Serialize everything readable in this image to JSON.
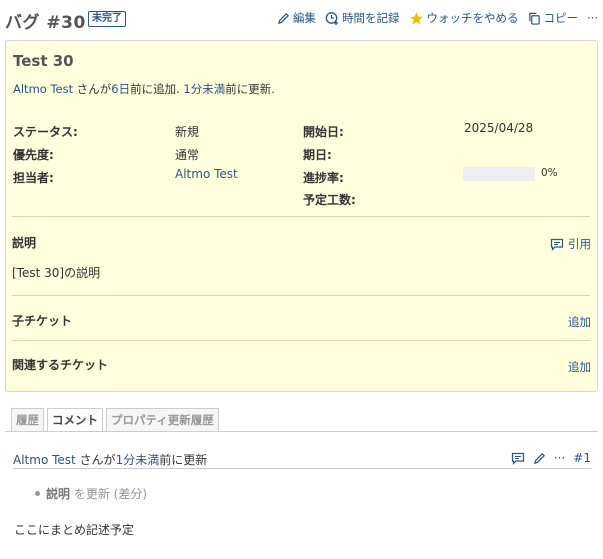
{
  "header": {
    "title": "バグ #30",
    "status_badge": "未完了",
    "actions": {
      "edit": "編集",
      "log_time": "時間を記録",
      "unwatch": "ウォッチをやめる",
      "copy": "コピー",
      "more": "···"
    }
  },
  "issue": {
    "subject": "Test 30",
    "author_line": {
      "author": "Altmo Test",
      "text1": " さんが",
      "added": "6日",
      "text2": "前に追加. ",
      "updated": "1分未満",
      "text3": "前に更新."
    },
    "attributes": {
      "status_label": "ステータス:",
      "status_value": "新規",
      "priority_label": "優先度:",
      "priority_value": "通常",
      "assignee_label": "担当者:",
      "assignee_value": "Altmo Test",
      "start_label": "開始日:",
      "start_value": "2025/04/28",
      "due_label": "期日:",
      "progress_label": "進捗率:",
      "progress_value": "0%",
      "progress_fraction": 0,
      "estimated_label": "予定工数:"
    },
    "description": {
      "label": "説明",
      "quote_label": "引用",
      "text": "[Test 30]の説明"
    },
    "subtasks": {
      "label": "子チケット",
      "add_label": "追加"
    },
    "relations": {
      "label": "関連するチケット",
      "add_label": "追加"
    }
  },
  "tabs": [
    "履歴",
    "コメント",
    "プロパティ更新履歴"
  ],
  "journal": {
    "author": "Altmo Test",
    "text1": " さんが",
    "time": "1分未満",
    "text2": "前に更新",
    "more": "···",
    "number": "#1",
    "detail_field": "説明",
    "detail_text": " を更新 (",
    "detail_link": "差分",
    "detail_close": ")",
    "notes": "ここにまとめ記述予定"
  },
  "colors": {
    "accent": "#2a5685",
    "issue_bg": "#ffffdd",
    "star": "#f0c000"
  }
}
